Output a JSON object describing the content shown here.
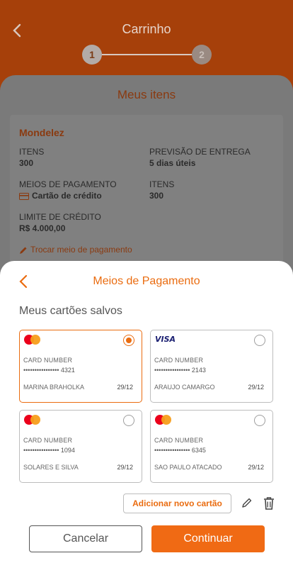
{
  "header": {
    "title": "Carrinho",
    "steps": [
      "1",
      "2"
    ]
  },
  "items_sheet": {
    "title": "Meus itens",
    "supplier": "Mondelez",
    "items_label": "ITENS",
    "items_value": "300",
    "delivery_label": "PREVISÃO DE ENTREGA",
    "delivery_value": "5 dias úteis",
    "payment_label": "MEIOS DE PAGAMENTO",
    "payment_value": "Cartão de crédito",
    "items2_label": "ITENS",
    "items2_value": "300",
    "credit_label": "LIMITE DE CRÉDITO",
    "credit_value": "R$ 4.000,00",
    "change_payment": "Trocar meio de pagamento"
  },
  "modal": {
    "title": "Meios de Pagamento",
    "section_title": "Meus cartões salvos",
    "cards": [
      {
        "brand": "mastercard-icon",
        "label": "CARD NUMBER",
        "number": "•••••••••••••••• 4321",
        "holder": "MARINA BRAHOLKA",
        "expiry": "29/12",
        "selected": true
      },
      {
        "brand": "visa-logo",
        "brand_text": "VISA",
        "label": "CARD NUMBER",
        "number": "•••••••••••••••• 2143",
        "holder": "ARAUJO CAMARGO",
        "expiry": "29/12",
        "selected": false
      },
      {
        "brand": "mastercard-icon",
        "label": "CARD NUMBER",
        "number": "•••••••••••••••• 1094",
        "holder": "SOLARES E SILVA",
        "expiry": "29/12",
        "selected": false
      },
      {
        "brand": "mastercard-icon",
        "label": "CARD NUMBER",
        "number": "•••••••••••••••• 6345",
        "holder": "SAO PAULO ATACADO",
        "expiry": "29/12",
        "selected": false
      }
    ],
    "add_card": "Adicionar novo cartão",
    "cancel": "Cancelar",
    "continue": "Continuar"
  },
  "colors": {
    "accent": "#ea6c10",
    "button_primary": "#f06a14",
    "overlay_header": "#a6400a"
  }
}
